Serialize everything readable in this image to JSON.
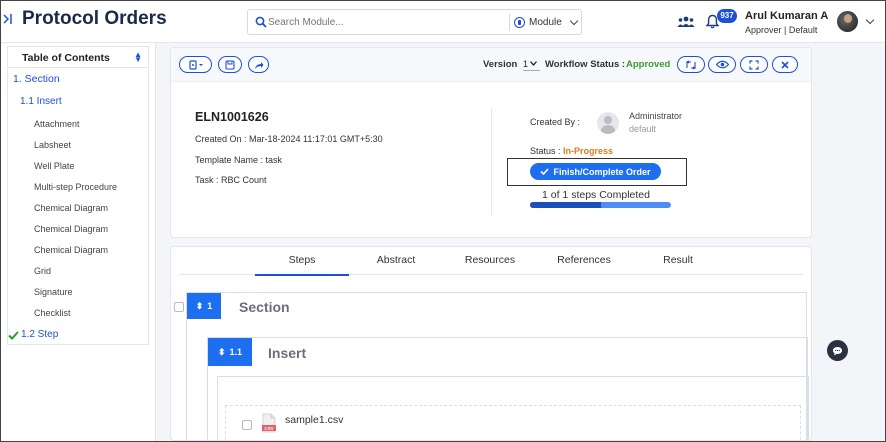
{
  "header": {
    "app_title": "Protocol Orders",
    "search_placeholder": "Search Module...",
    "module_label": "Module",
    "notification_count": "937",
    "user_name": "Arul Kumaran A",
    "user_role": "Approver | Default"
  },
  "sidebar": {
    "title": "Table of Contents",
    "items": [
      {
        "label": "1. Section"
      },
      {
        "label": "1.1 Insert"
      },
      {
        "label": "Attachment"
      },
      {
        "label": "Labsheet"
      },
      {
        "label": "Well Plate"
      },
      {
        "label": "Multi-step Procedure"
      },
      {
        "label": "Chemical Diagram"
      },
      {
        "label": "Chemical Diagram"
      },
      {
        "label": "Chemical Diagram"
      },
      {
        "label": "Grid"
      },
      {
        "label": "Signature"
      },
      {
        "label": "Checklist"
      },
      {
        "label": "1.2  Step"
      }
    ]
  },
  "toolbar": {
    "version_label": "Version",
    "version_value": "1",
    "workflow_label": "Workflow Status :",
    "workflow_status": "Approved"
  },
  "details": {
    "eln_id": "ELN1001626",
    "created_on": "Created On : Mar-18-2024 11:17:01 GMT+5:30",
    "template_name": "Template Name : task",
    "task": "Task : RBC Count",
    "created_by_label": "Created By :",
    "creator_name": "Administrator",
    "creator_sub": "default",
    "status_label": "Status :",
    "status_value": "In-Progress",
    "finish_button": "Finish/Complete Order",
    "steps_completed": "1 of 1 steps Completed",
    "progress_fraction": 0.5
  },
  "tabs": [
    {
      "label": "Steps"
    },
    {
      "label": "Abstract"
    },
    {
      "label": "Resources"
    },
    {
      "label": "References"
    },
    {
      "label": "Result"
    }
  ],
  "content": {
    "section_number": "1",
    "section_title": "Section",
    "insert_number": "1.1",
    "insert_title": "Insert",
    "file_name": "sample1.csv",
    "file_type": "CSV"
  },
  "colors": {
    "accent": "#1e4fd8",
    "button_blue": "#1e6ff0",
    "approved_green": "#3d9a2e",
    "in_progress_orange": "#e87a1a"
  }
}
